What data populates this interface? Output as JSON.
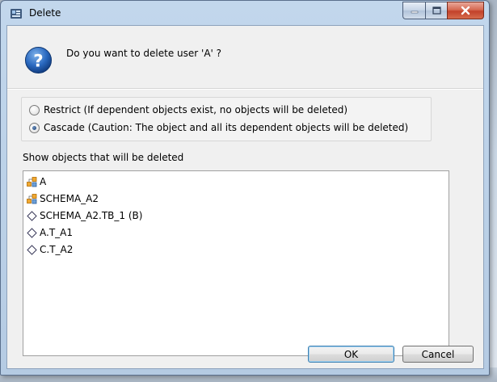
{
  "window": {
    "title": "Delete"
  },
  "dialog": {
    "question": "Do you want to delete user 'A' ?",
    "options": [
      {
        "label": "Restrict (If dependent objects exist, no objects will be deleted)",
        "selected": false
      },
      {
        "label": "Cascade (Caution: The object and all its dependent objects will be deleted)",
        "selected": true
      }
    ],
    "list_label": "Show objects that will be deleted",
    "objects": [
      {
        "label": "A",
        "icon": "schema-icon"
      },
      {
        "label": "SCHEMA_A2",
        "icon": "schema-icon"
      },
      {
        "label": "SCHEMA_A2.TB_1 (B)",
        "icon": "diamond-icon"
      },
      {
        "label": "A.T_A1",
        "icon": "diamond-icon"
      },
      {
        "label": "C.T_A2",
        "icon": "diamond-icon"
      }
    ]
  },
  "buttons": {
    "ok": "OK",
    "cancel": "Cancel"
  },
  "colors": {
    "accent": "#3c7fb1",
    "close": "#c2412a",
    "question_icon": "#1f5fb4"
  }
}
